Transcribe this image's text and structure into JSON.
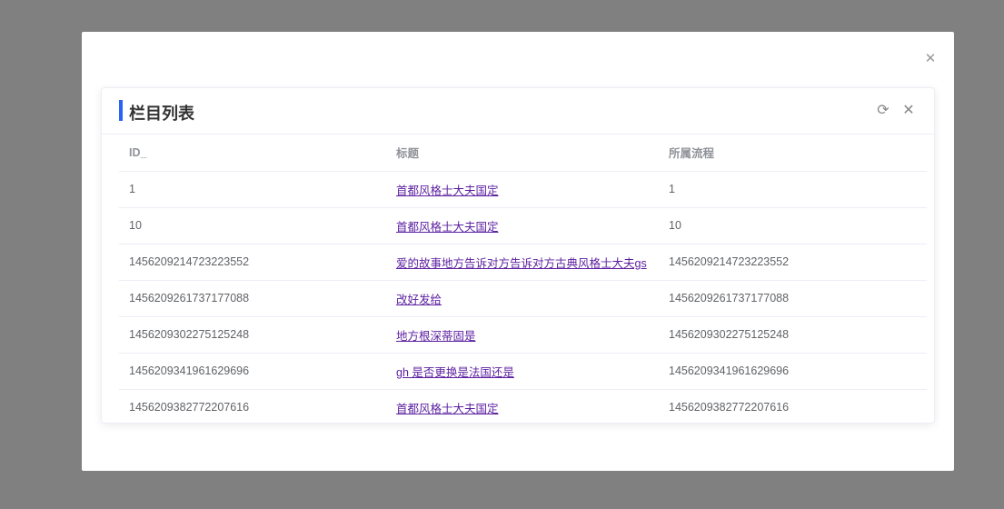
{
  "modal": {
    "close_icon": "close-icon"
  },
  "card": {
    "title": "栏目列表",
    "refresh_icon": "refresh-icon",
    "close_icon": "close-icon",
    "accent": "#2b64f5"
  },
  "table": {
    "headers": [
      "ID_",
      "标题",
      "所属流程"
    ],
    "rows": [
      {
        "id": "1",
        "title": "首都风格士大夫国定",
        "process": "1"
      },
      {
        "id": "10",
        "title": "首都风格士大夫国定",
        "process": "10"
      },
      {
        "id": "1456209214723223552",
        "title": "爱的故事地方告诉对方告诉对方古典风格士大夫gs",
        "process": "1456209214723223552"
      },
      {
        "id": "1456209261737177088",
        "title": "改好发给",
        "process": "1456209261737177088"
      },
      {
        "id": "1456209302275125248",
        "title": "地方根深蒂固是",
        "process": "1456209302275125248"
      },
      {
        "id": "1456209341961629696",
        "title": "gh 是否更换是法国还是",
        "process": "1456209341961629696"
      },
      {
        "id": "1456209382772207616",
        "title": "首都风格士大夫国定",
        "process": "1456209382772207616"
      }
    ]
  }
}
